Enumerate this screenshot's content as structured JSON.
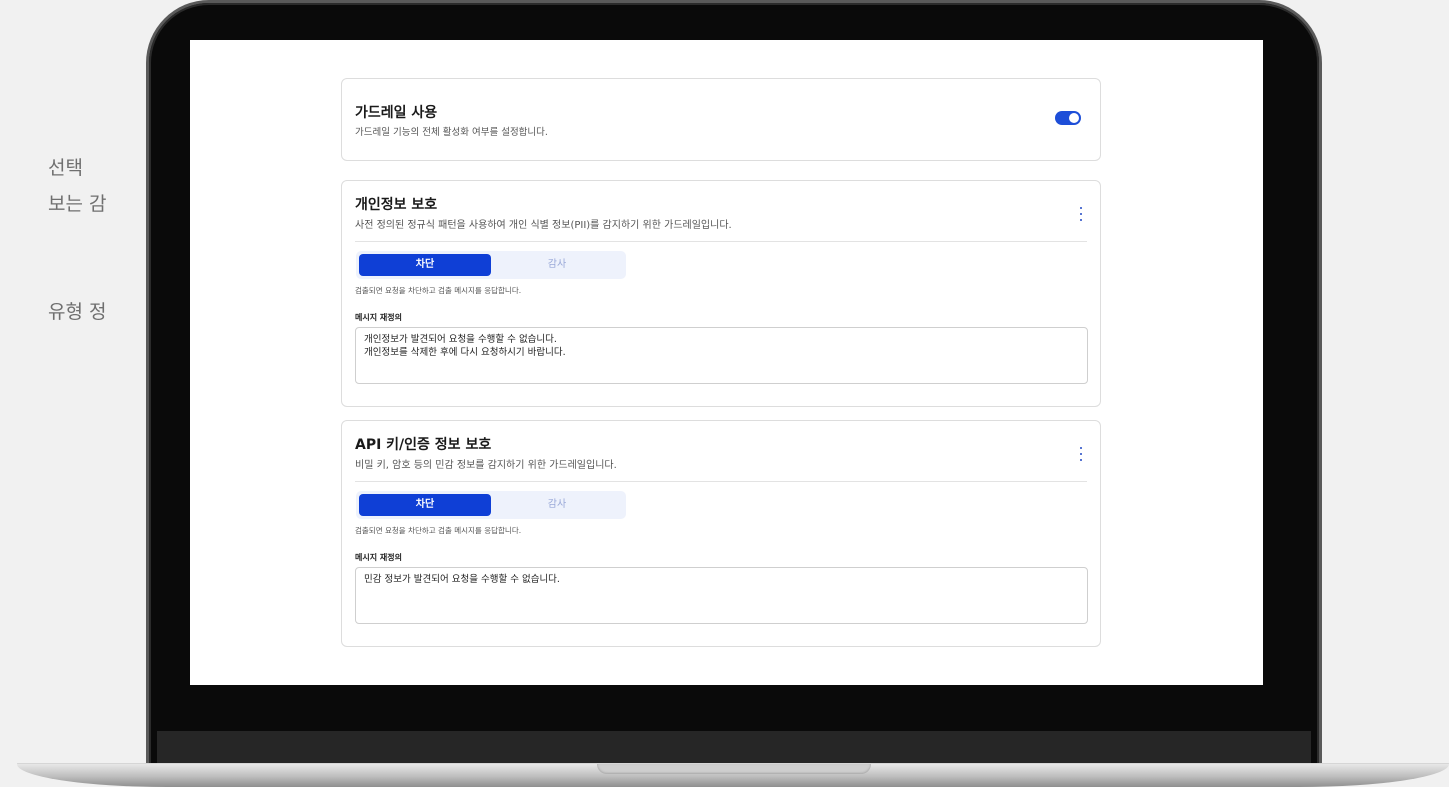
{
  "background": {
    "lines": [
      "선택",
      "보는 감",
      "유형 정"
    ]
  },
  "colors": {
    "accent": "#0f3fd6",
    "toggle_on": "#1d4ed8",
    "segment_bg": "#eef2fc"
  },
  "guardrail_toggle": {
    "title": "가드레일 사용",
    "description": "가드레일 기능의 전체 활성화 여부를 설정합니다.",
    "enabled": true
  },
  "cards": [
    {
      "title": "개인정보 보호",
      "description": "사전 정의된 정규식 패턴을 사용하여 개인 식별 정보(PII)를 감지하기 위한 가드레일입니다.",
      "mode_options": [
        "차단",
        "감사"
      ],
      "selected_mode": "차단",
      "mode_help": "검출되면 요청을 차단하고 검출 메시지를 응답합니다.",
      "message_label": "메시지 재정의",
      "message_value": "개인정보가 발견되어 요청을 수행할 수 없습니다.\n개인정보를 삭제한 후에 다시 요청하시기 바랍니다."
    },
    {
      "title": "API 키/인증 정보 보호",
      "description": "비밀 키, 암호 등의 민감 정보를 감지하기 위한 가드레일입니다.",
      "mode_options": [
        "차단",
        "감사"
      ],
      "selected_mode": "차단",
      "mode_help": "검출되면 요청을 차단하고 검출 메시지를 응답합니다.",
      "message_label": "메시지 재정의",
      "message_value": "민감 정보가 발견되어 요청을 수행할 수 없습니다."
    }
  ]
}
